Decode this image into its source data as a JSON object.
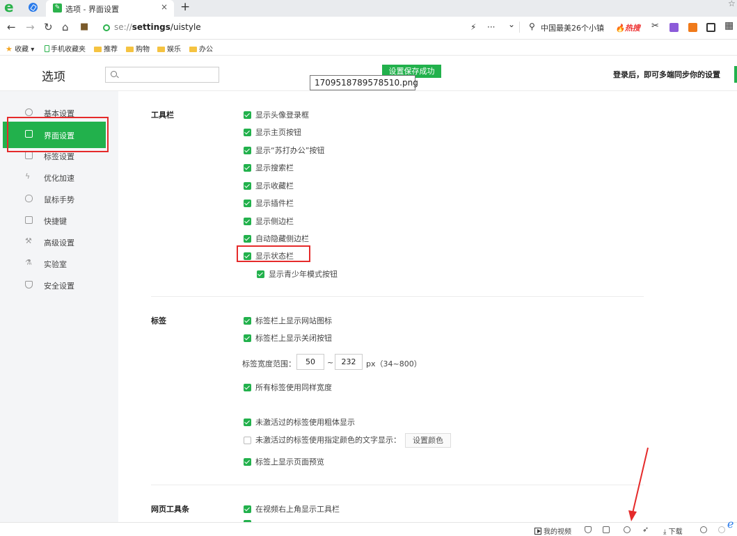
{
  "tabs": {
    "active_title": "选项 - 界面设置",
    "close": "×",
    "new_tab": "+"
  },
  "nav": {
    "address_scheme": "se://",
    "address_path": "settings",
    "address_rest": "/uistyle",
    "more": "···",
    "dropdown": "⌄",
    "search_text": "中国最美26个小镇",
    "hot_label": "热搜"
  },
  "bookmarks": [
    {
      "label": "收藏",
      "icon": "star-icon"
    },
    {
      "label": "手机收藏夹",
      "icon": "phone-icon"
    },
    {
      "label": "推荐",
      "icon": "folder-icon"
    },
    {
      "label": "购物",
      "icon": "folder-icon"
    },
    {
      "label": "娱乐",
      "icon": "folder-icon"
    },
    {
      "label": "办公",
      "icon": "folder-icon"
    }
  ],
  "header": {
    "title": "选项",
    "search_placeholder": "",
    "toast": "设置保存成功",
    "file_tooltip": "1709518789578510.png",
    "login_tip": "登录后，即可多端同步你的设置"
  },
  "sidebar": {
    "items": [
      {
        "label": "基本设置",
        "icon": "gear-icon"
      },
      {
        "label": "界面设置",
        "icon": "window-icon",
        "active": true
      },
      {
        "label": "标签设置",
        "icon": "tab-icon"
      },
      {
        "label": "优化加速",
        "icon": "lightning-icon"
      },
      {
        "label": "鼠标手势",
        "icon": "mouse-icon"
      },
      {
        "label": "快捷键",
        "icon": "keyboard-icon"
      },
      {
        "label": "高级设置",
        "icon": "wrench-icon"
      },
      {
        "label": "实验室",
        "icon": "flask-icon"
      },
      {
        "label": "安全设置",
        "icon": "shield-icon"
      }
    ]
  },
  "toolbar_section": {
    "title": "工具栏",
    "options": [
      {
        "label": "显示头像登录框",
        "checked": true
      },
      {
        "label": "显示主页按钮",
        "checked": true
      },
      {
        "label": "显示“苏打办公”按钮",
        "checked": true
      },
      {
        "label": "显示搜索栏",
        "checked": true
      },
      {
        "label": "显示收藏栏",
        "checked": true
      },
      {
        "label": "显示插件栏",
        "checked": true
      },
      {
        "label": "显示侧边栏",
        "checked": true
      },
      {
        "label": "自动隐藏侧边栏",
        "checked": true
      },
      {
        "label": "显示状态栏",
        "checked": true
      },
      {
        "label": "显示青少年模式按钮",
        "checked": true
      }
    ]
  },
  "tabs_section": {
    "title": "标签",
    "options": [
      {
        "label": "标签栏上显示网站图标",
        "checked": true
      },
      {
        "label": "标签栏上显示关闭按钮",
        "checked": true
      }
    ],
    "width_label": "标签宽度范围：",
    "width_min": "50",
    "width_sep": "~",
    "width_max": "232",
    "width_unit": "px（34~800）",
    "options2": [
      {
        "label": "所有标签使用同样宽度",
        "checked": true
      },
      {
        "label": "未激活过的标签使用粗体显示",
        "checked": true
      },
      {
        "label": "未激活过的标签使用指定颜色的文字显示：",
        "checked": false
      },
      {
        "label": "标签上显示页面预览",
        "checked": true
      }
    ],
    "color_button": "设置颜色"
  },
  "webtoolbar_section": {
    "title": "网页工具条",
    "options": [
      {
        "label": "在视频右上角显示工具栏",
        "checked": true
      }
    ]
  },
  "statusbar": {
    "video": "我的视频",
    "download": "下载"
  },
  "colors": {
    "accent": "#22b14c",
    "annotation_red": "#e52a2a"
  }
}
